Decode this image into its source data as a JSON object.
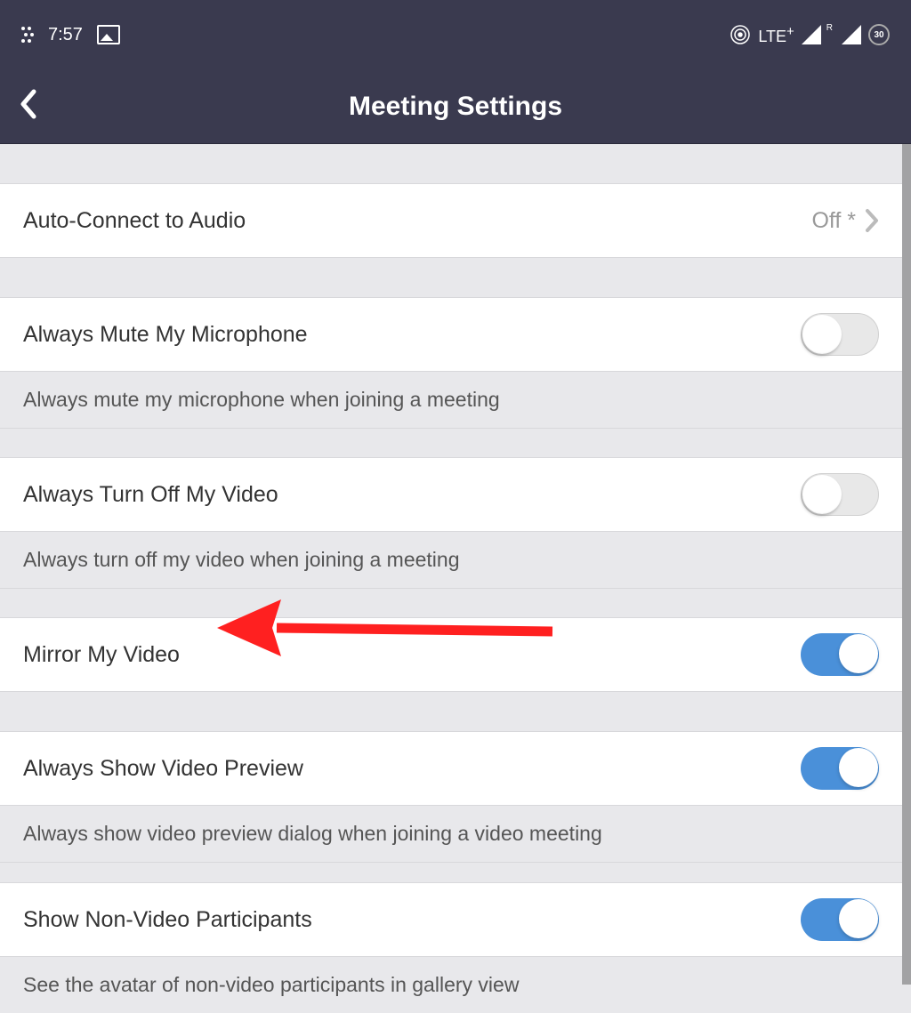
{
  "statusBar": {
    "time": "7:57",
    "network": "LTE",
    "plus": "+",
    "roaming": "R",
    "battery": "30"
  },
  "header": {
    "title": "Meeting Settings"
  },
  "settings": {
    "autoConnect": {
      "label": "Auto-Connect to Audio",
      "value": "Off *"
    },
    "muteMic": {
      "label": "Always Mute My Microphone",
      "desc": "Always mute my microphone when joining a meeting"
    },
    "turnOffVideo": {
      "label": "Always Turn Off My Video",
      "desc": "Always turn off my video when joining a meeting"
    },
    "mirrorVideo": {
      "label": "Mirror My Video"
    },
    "videoPreview": {
      "label": "Always Show Video Preview",
      "desc": "Always show video preview dialog when joining a video meeting"
    },
    "nonVideo": {
      "label": "Show Non-Video Participants",
      "desc": "See the avatar of non-video participants in gallery view"
    }
  }
}
